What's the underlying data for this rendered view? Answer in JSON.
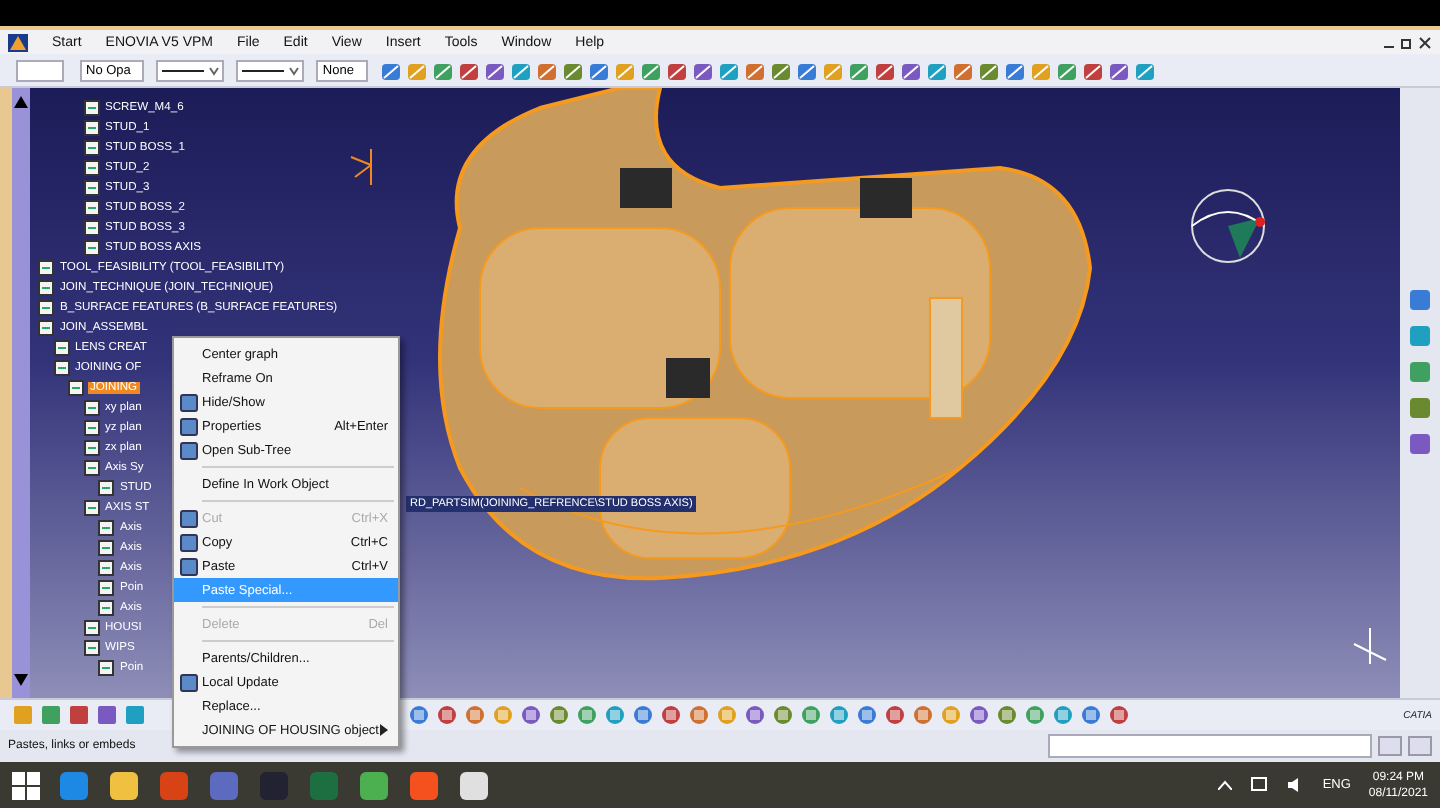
{
  "menu_bar": {
    "items": [
      "Start",
      "ENOVIA V5 VPM",
      "File",
      "Edit",
      "View",
      "Insert",
      "Tools",
      "Window",
      "Help"
    ]
  },
  "toolbar": {
    "dropdowns": [
      {
        "kind": "text",
        "value": "No Opa"
      },
      {
        "kind": "line"
      },
      {
        "kind": "line"
      },
      {
        "kind": "text",
        "value": "None"
      }
    ]
  },
  "tree": {
    "continued_children": [
      {
        "label": "SCREW_M4_6",
        "selected": false
      },
      {
        "label": "STUD_1",
        "selected": false
      },
      {
        "label": "STUD BOSS_1",
        "selected": false
      },
      {
        "label": "STUD_2",
        "selected": false
      },
      {
        "label": "STUD_3",
        "selected": false
      },
      {
        "label": "STUD BOSS_2",
        "selected": false
      },
      {
        "label": "STUD BOSS_3",
        "selected": false
      },
      {
        "label": "STUD BOSS AXIS",
        "selected": false
      }
    ],
    "items": [
      {
        "label": "TOOL_FEASIBILITY (TOOL_FEASIBILITY)",
        "selected": false
      },
      {
        "label": "JOIN_TECHNIQUE (JOIN_TECHNIQUE)",
        "selected": false
      },
      {
        "label": "B_SURFACE FEATURES (B_SURFACE FEATURES)",
        "selected": false
      },
      {
        "label": "JOIN_ASSEMBL",
        "selected": false,
        "children": [
          {
            "label": "LENS CREAT",
            "selected": false
          },
          {
            "label": "JOINING OF",
            "selected": false,
            "children": [
              {
                "label": "JOINING",
                "selected": true,
                "children": [
                  {
                    "label": "xy plan",
                    "selected": false
                  },
                  {
                    "label": "yz plan",
                    "selected": false
                  },
                  {
                    "label": "zx plan",
                    "selected": false
                  },
                  {
                    "label": "Axis Sy",
                    "selected": false,
                    "children": [
                      {
                        "label": "STUD",
                        "selected": false
                      }
                    ]
                  },
                  {
                    "label": "AXIS ST",
                    "selected": false,
                    "children": [
                      {
                        "label": "Axis",
                        "selected": false
                      },
                      {
                        "label": "Axis",
                        "selected": false
                      },
                      {
                        "label": "Axis",
                        "selected": false
                      },
                      {
                        "label": "Poin",
                        "selected": false
                      },
                      {
                        "label": "Axis",
                        "selected": false
                      }
                    ]
                  },
                  {
                    "label": "HOUSI",
                    "selected": false
                  },
                  {
                    "label": "WIPS",
                    "selected": false,
                    "children": [
                      {
                        "label": "Poin",
                        "selected": false
                      }
                    ]
                  }
                ]
              }
            ]
          }
        ]
      }
    ]
  },
  "tooltip": "RD_PARTSIM(JOINING_REFRENCE\\STUD BOSS AXIS)",
  "context_menu": {
    "items": [
      {
        "kind": "item",
        "label": "Center graph",
        "has_icon": false,
        "disabled": false,
        "selected": false
      },
      {
        "kind": "item",
        "label": "Reframe On",
        "has_icon": false,
        "disabled": false,
        "selected": false
      },
      {
        "kind": "item",
        "label": "Hide/Show",
        "has_icon": true,
        "disabled": false,
        "selected": false
      },
      {
        "kind": "item",
        "label": "Properties",
        "shortcut": "Alt+Enter",
        "has_icon": true,
        "disabled": false,
        "selected": false
      },
      {
        "kind": "item",
        "label": "Open Sub-Tree",
        "has_icon": true,
        "disabled": false,
        "selected": false
      },
      {
        "kind": "separator"
      },
      {
        "kind": "item",
        "label": "Define In Work Object",
        "has_icon": false,
        "disabled": false,
        "selected": false
      },
      {
        "kind": "separator"
      },
      {
        "kind": "item",
        "label": "Cut",
        "shortcut": "Ctrl+X",
        "has_icon": true,
        "disabled": true,
        "selected": false
      },
      {
        "kind": "item",
        "label": "Copy",
        "shortcut": "Ctrl+C",
        "has_icon": true,
        "disabled": false,
        "selected": false
      },
      {
        "kind": "item",
        "label": "Paste",
        "shortcut": "Ctrl+V",
        "has_icon": true,
        "disabled": false,
        "selected": false
      },
      {
        "kind": "item",
        "label": "Paste Special...",
        "has_icon": false,
        "disabled": false,
        "selected": true
      },
      {
        "kind": "separator"
      },
      {
        "kind": "item",
        "label": "Delete",
        "shortcut": "Del",
        "has_icon": false,
        "disabled": true,
        "selected": false
      },
      {
        "kind": "separator"
      },
      {
        "kind": "item",
        "label": "Parents/Children...",
        "has_icon": false,
        "disabled": false,
        "selected": false
      },
      {
        "kind": "item",
        "label": "Local Update",
        "has_icon": true,
        "disabled": false,
        "selected": false
      },
      {
        "kind": "item",
        "label": "Replace...",
        "has_icon": false,
        "disabled": false,
        "selected": false
      },
      {
        "kind": "item",
        "label": "JOINING OF HOUSING object",
        "has_icon": false,
        "disabled": false,
        "selected": false,
        "submenu": true
      }
    ]
  },
  "logo_text": "CATIA",
  "status_bar": {
    "message": "Pastes, links or embeds"
  },
  "taskbar": {
    "language": "ENG",
    "time": "09:24 PM",
    "date": "08/11/2021"
  }
}
